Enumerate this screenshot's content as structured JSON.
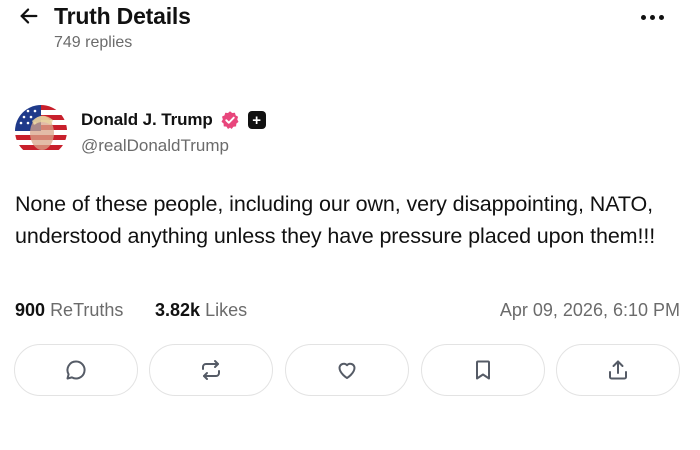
{
  "header": {
    "title": "Truth Details",
    "replies": "749 replies"
  },
  "author": {
    "name": "Donald J. Trump",
    "handle": "@realDonaldTrump",
    "verified_color": "#e8467c",
    "avatar_colors": [
      "#c8202c",
      "#ffffff",
      "#1f3a8a"
    ]
  },
  "post": {
    "text": "None of these people, including our own, very disappointing, NATO, understood anything unless they have pressure placed upon them!!!"
  },
  "stats": {
    "retruths_count": "900",
    "retruths_label": "ReTruths",
    "likes_count": "3.82k",
    "likes_label": "Likes",
    "timestamp": "Apr 09, 2026, 6:10 PM"
  },
  "actions": [
    {
      "icon": "comment-icon"
    },
    {
      "icon": "retruth-icon"
    },
    {
      "icon": "heart-icon"
    },
    {
      "icon": "bookmark-icon"
    },
    {
      "icon": "share-icon"
    }
  ],
  "colors": {
    "text": "#111111",
    "muted": "#6b6b6b",
    "border": "#e3e3e3",
    "icon": "#555b66"
  }
}
